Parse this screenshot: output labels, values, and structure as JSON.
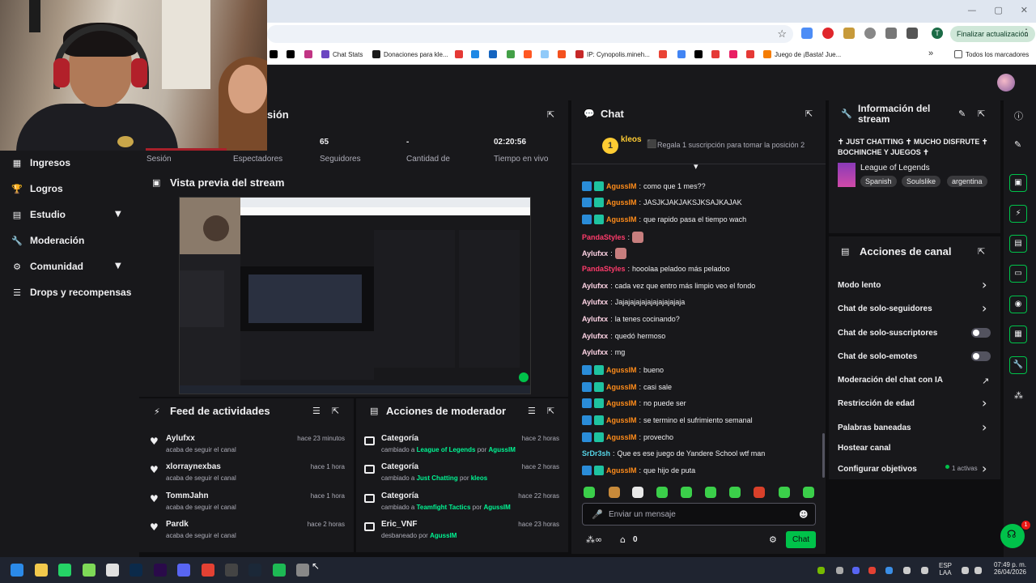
{
  "browser": {
    "window_controls": [
      "—",
      "▢",
      "✕"
    ],
    "update_button": "Finalizar actualización",
    "profile_letter": "T",
    "bookmarks": [
      {
        "label": "",
        "color": "#000000"
      },
      {
        "label": "",
        "color": "#000000"
      },
      {
        "label": "",
        "color": "#c13584"
      },
      {
        "label": "Chat Stats",
        "color": "#6b46c1"
      },
      {
        "label": "Donaciones para kle...",
        "color": "#1a1a1a"
      },
      {
        "label": "",
        "color": "#e53935"
      },
      {
        "label": "",
        "color": "#1e88e5"
      },
      {
        "label": "",
        "color": "#1565c0"
      },
      {
        "label": "",
        "color": "#43a047"
      },
      {
        "label": "",
        "color": "#ff5722"
      },
      {
        "label": "",
        "color": "#90caf9"
      },
      {
        "label": "",
        "color": "#f4511e"
      },
      {
        "label": "IP: Cynopolis.mineh...",
        "color": "#c62828"
      },
      {
        "label": "",
        "color": "#ea4335"
      },
      {
        "label": "",
        "color": "#4285f4"
      },
      {
        "label": "",
        "color": "#000000"
      },
      {
        "label": "",
        "color": "#e53935"
      },
      {
        "label": "",
        "color": "#e91e63"
      },
      {
        "label": "",
        "color": "#e53935"
      },
      {
        "label": "Juego de ¡Basta! Jue...",
        "color": "#f57c00"
      }
    ],
    "bookmarks_folder": "Todos los marcadores"
  },
  "sidebar": {
    "items": [
      {
        "label": "Ingresos",
        "icon": "▦",
        "chevron": false
      },
      {
        "label": "Logros",
        "icon": "🏆",
        "chevron": false
      },
      {
        "label": "Estudio",
        "icon": "▤",
        "chevron": true
      },
      {
        "label": "Moderación",
        "icon": "🔧",
        "chevron": false
      },
      {
        "label": "Comunidad",
        "icon": "⚙",
        "chevron": true
      },
      {
        "label": "Drops y recompensas",
        "icon": "☰",
        "chevron": false
      }
    ]
  },
  "session": {
    "title_fragment": "sión",
    "stats": [
      {
        "value": "",
        "label": "Sesión"
      },
      {
        "value": "",
        "label": "Espectadores"
      },
      {
        "value": "65",
        "label": "Seguidores"
      },
      {
        "value": "-",
        "label": "Cantidad de"
      },
      {
        "value": "02:20:56",
        "label": "Tiempo en vivo"
      }
    ]
  },
  "preview": {
    "title": "Vista previa del stream"
  },
  "activity": {
    "title": "Feed de actividades",
    "items": [
      {
        "name": "Aylufxx",
        "sub": "acaba de seguir el canal",
        "time": "hace 23 minutos"
      },
      {
        "name": "xlorraynexbas",
        "sub": "acaba de seguir el canal",
        "time": "hace 1 hora"
      },
      {
        "name": "TommJahn",
        "sub": "acaba de seguir el canal",
        "time": "hace 1 hora"
      },
      {
        "name": "Pardk",
        "sub": "acaba de seguir el canal",
        "time": "hace 2 horas"
      }
    ]
  },
  "mod_actions": {
    "title": "Acciones de moderador",
    "items": [
      {
        "title": "Categoría",
        "prefix": "cambiado a",
        "target": "League of Legends",
        "by": "por",
        "user": "AgussIM",
        "time": "hace 2 horas"
      },
      {
        "title": "Categoría",
        "prefix": "cambiado a",
        "target": "Just Chatting",
        "by": "por",
        "user": "kleos",
        "time": "hace 2 horas"
      },
      {
        "title": "Categoría",
        "prefix": "cambiado a",
        "target": "Teamfight Tactics",
        "by": "por",
        "user": "AgussIM",
        "time": "hace 22 horas"
      },
      {
        "title": "Eric_VNF",
        "prefix": "desbaneado",
        "target": "",
        "by": "por",
        "user": "AgussIM",
        "time": "hace 23 horas"
      }
    ]
  },
  "chat": {
    "title": "Chat",
    "top_user": "kleos",
    "top_rank": "1",
    "gift_prompt": "Regala 1 suscripción para tomar la posición 2",
    "messages": [
      {
        "user": "AgussIM",
        "color": "#ff8c1a",
        "badges": true,
        "text": "como que 1 mes??",
        "emote": false
      },
      {
        "user": "AgussIM",
        "color": "#ff8c1a",
        "badges": true,
        "text": "JASJKJAKJAKSJKSAJKAJAK",
        "emote": false
      },
      {
        "user": "AgussIM",
        "color": "#ff8c1a",
        "badges": true,
        "text": "que rapido pasa el tiempo wach",
        "emote": false
      },
      {
        "user": "PandaStyles",
        "color": "#ff3b6b",
        "badges": false,
        "text": "",
        "emote": true
      },
      {
        "user": "Aylufxx",
        "color": "#ffd4e5",
        "badges": false,
        "text": "",
        "emote": true
      },
      {
        "user": "PandaStyles",
        "color": "#ff3b6b",
        "badges": false,
        "text": "hooolaa peladoo más peladoo",
        "emote": false
      },
      {
        "user": "Aylufxx",
        "color": "#ffd4e5",
        "badges": false,
        "text": "cada vez que entro más limpio veo el fondo",
        "emote": false
      },
      {
        "user": "Aylufxx",
        "color": "#ffd4e5",
        "badges": false,
        "text": "Jajajajajajajajajajajaja",
        "emote": false
      },
      {
        "user": "Aylufxx",
        "color": "#ffd4e5",
        "badges": false,
        "text": "la tenes cocinando?",
        "emote": false
      },
      {
        "user": "Aylufxx",
        "color": "#ffd4e5",
        "badges": false,
        "text": "quedó hermoso",
        "emote": false
      },
      {
        "user": "Aylufxx",
        "color": "#ffd4e5",
        "badges": false,
        "text": "mg",
        "emote": false
      },
      {
        "user": "AgussIM",
        "color": "#ff8c1a",
        "badges": true,
        "text": "bueno",
        "emote": false
      },
      {
        "user": "AgussIM",
        "color": "#ff8c1a",
        "badges": true,
        "text": "casi sale",
        "emote": false
      },
      {
        "user": "AgussIM",
        "color": "#ff8c1a",
        "badges": true,
        "text": "no puede ser",
        "emote": false
      },
      {
        "user": "AgussIM",
        "color": "#ff8c1a",
        "badges": true,
        "text": "se termino el sufrimiento semanal",
        "emote": false
      },
      {
        "user": "AgussIM",
        "color": "#ff8c1a",
        "badges": true,
        "text": "provecho",
        "emote": false
      },
      {
        "user": "SrDr3sh",
        "color": "#56d6e8",
        "badges": false,
        "text": "Que es ese juego de Yandere School wtf man",
        "emote": false
      },
      {
        "user": "AgussIM",
        "color": "#ff8c1a",
        "badges": true,
        "text": "que hijo de puta",
        "emote": false
      }
    ],
    "input_placeholder": "Enviar un mensaje",
    "points_count": "0",
    "send_label": "Chat"
  },
  "info": {
    "title": "Información del stream",
    "stream_title": "✝ JUST CHATTING ✝ MUCHO DISFRUTE ✝ BOCHINCHE Y JUEGOS ✝",
    "category": "League of Legends",
    "tags": [
      "Spanish",
      "Soulslike",
      "argentina"
    ]
  },
  "channel_actions": {
    "title": "Acciones de canal",
    "rows": [
      {
        "label": "Modo lento",
        "control": "chevron"
      },
      {
        "label": "Chat de solo-seguidores",
        "control": "chevron"
      },
      {
        "label": "Chat de solo-suscriptores",
        "control": "toggle"
      },
      {
        "label": "Chat de solo-emotes",
        "control": "toggle"
      },
      {
        "label": "Moderación del chat con IA",
        "control": "external"
      },
      {
        "label": "Restricción de edad",
        "control": "chevron"
      },
      {
        "label": "Palabras baneadas",
        "control": "chevron"
      },
      {
        "label": "Hostear canal",
        "control": "none"
      },
      {
        "label": "Configurar objetivos",
        "control": "chevron"
      }
    ],
    "goals_active": "1 activas"
  },
  "help_badge": "1",
  "taskbar": {
    "lang_top": "ESP",
    "lang_bottom": "LAA",
    "time": "07:49 p. m.",
    "date": "26/04/2026"
  },
  "colors": {
    "accent": "#00c24a",
    "bg": "#0e0e10",
    "panel": "#18181b"
  }
}
